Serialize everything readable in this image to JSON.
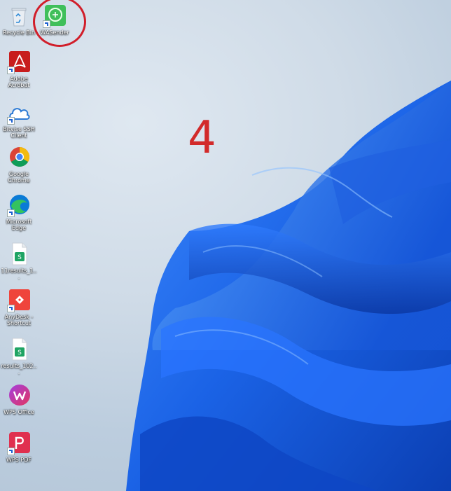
{
  "desktop": {
    "icons": [
      {
        "name": "recycle-bin",
        "label": "Recycle Bin"
      },
      {
        "name": "wasender",
        "label": "WASender"
      },
      {
        "name": "adobe-acrobat",
        "label": "Adobe Acrobat"
      },
      {
        "name": "bitvise-ssh-client",
        "label": "Bitvise SSH Client"
      },
      {
        "name": "google-chrome",
        "label": "Google Chrome"
      },
      {
        "name": "microsoft-edge",
        "label": "Microsoft Edge"
      },
      {
        "name": "results-file-1",
        "label": "11results_1..."
      },
      {
        "name": "anydesk-shortcut",
        "label": "AnyDesk - Shortcut"
      },
      {
        "name": "results-file-2",
        "label": "results_102..."
      },
      {
        "name": "wps-office",
        "label": "WPS Office"
      },
      {
        "name": "wps-pdf",
        "label": "WPS PDF"
      }
    ]
  },
  "annotation": {
    "step_number": "4",
    "color": "#d22a2a"
  },
  "theme": {
    "wallpaper_blue": "#1b63e6"
  }
}
